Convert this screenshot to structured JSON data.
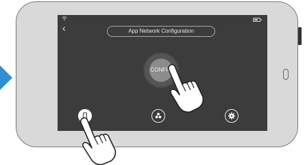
{
  "screen": {
    "title": "App Network Configuration",
    "back_icon": "‹",
    "config_label": "CONFIG"
  },
  "icons": {
    "status_wifi": "wifi-icon",
    "battery": "battery-icon",
    "nav": [
      "phone-icon",
      "fan-icon",
      "gear-icon"
    ]
  },
  "colors": {
    "screen_bg": "#3c3c3c",
    "phone_body": "#d9d9d9",
    "config_button": "#8c8c8c",
    "arrow": "#2f8fd0"
  }
}
